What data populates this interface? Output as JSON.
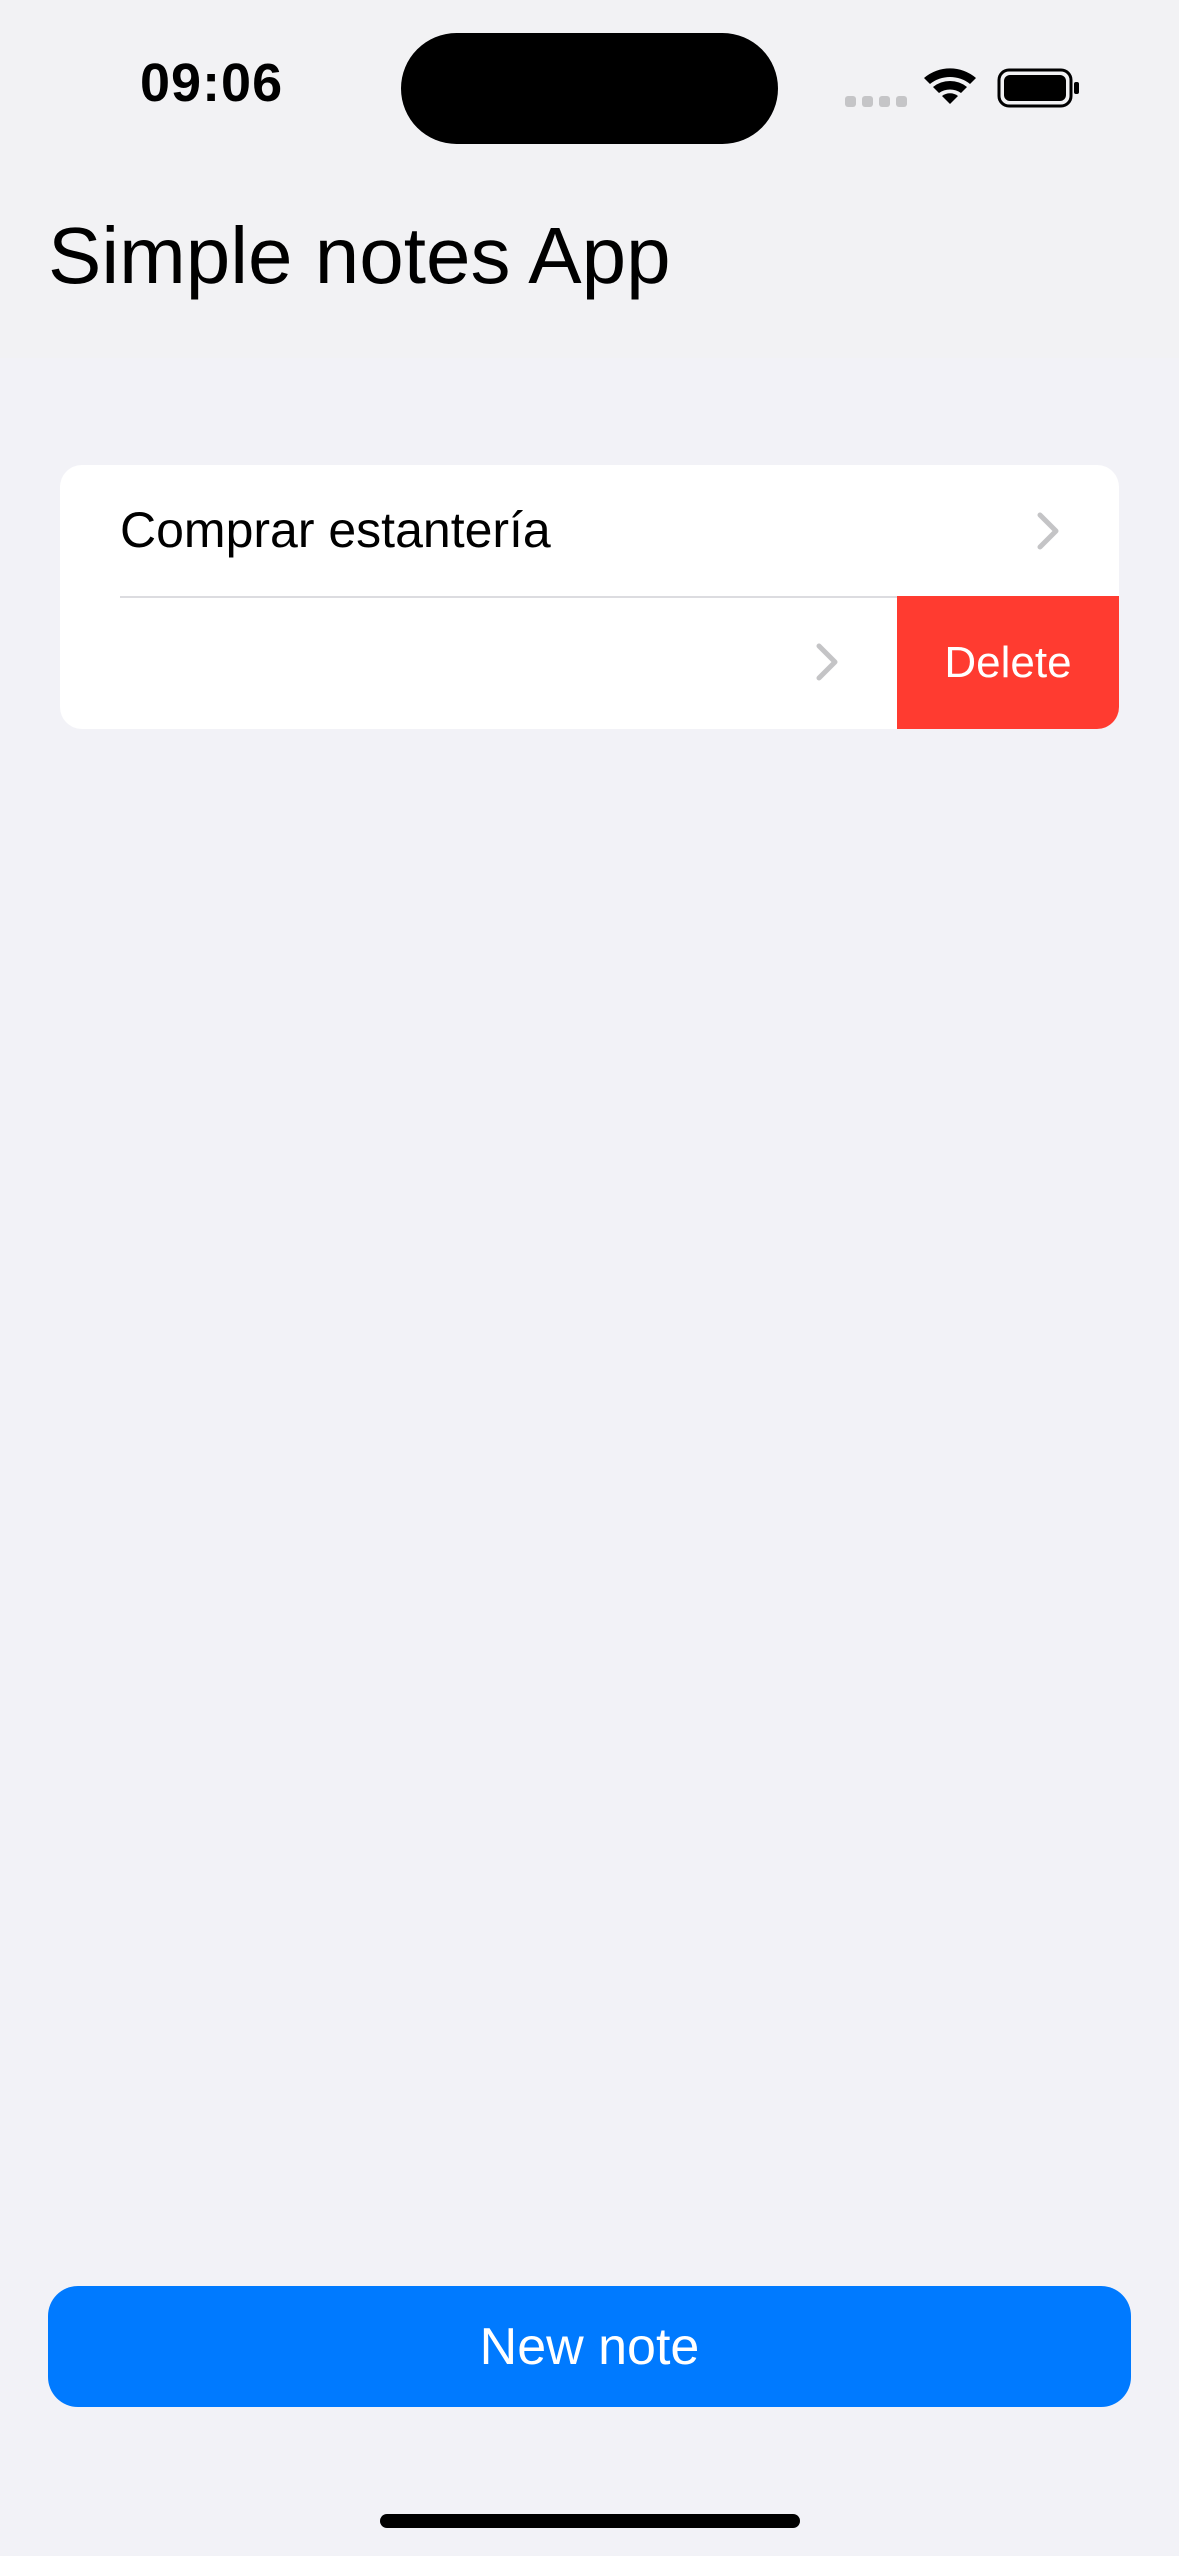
{
  "status_bar": {
    "time": "09:06",
    "icons": [
      "cellular-signal-icon",
      "wifi-icon",
      "battery-icon"
    ]
  },
  "nav": {
    "title": "Simple notes App"
  },
  "notes": {
    "items": [
      {
        "label": "Comprar estantería"
      },
      {
        "label": ""
      }
    ],
    "swipe_action": {
      "label": "Delete",
      "color": "#ff3b30"
    }
  },
  "footer": {
    "new_note_label": "New note",
    "accent_color": "#007aff"
  }
}
